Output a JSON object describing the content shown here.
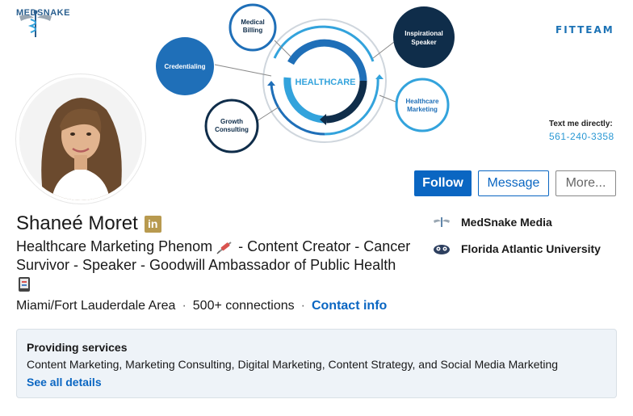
{
  "banner": {
    "brand_name": "MEDSNAKE",
    "center_label": "HEALTHCARE",
    "bubbles": {
      "medical_billing": "Medical Billing",
      "credentialing": "Credentialing",
      "growth_consulting": "Growth Consulting",
      "inspirational_speaker": "Inspirational Speaker",
      "healthcare_marketing": "Healthcare Marketing"
    },
    "sponsor": "FITTEAM",
    "text_me": "Text me directly:",
    "phone": "561-240-3358"
  },
  "actions": {
    "follow": "Follow",
    "message": "Message",
    "more": "More..."
  },
  "profile": {
    "name": "Shaneé Moret",
    "badge": "in",
    "headline_part1": "Healthcare Marketing Phenom",
    "headline_part2": "- Content Creator - Cancer Survivor - Speaker - Goodwill Ambassador of Public Health",
    "location": "Miami/Fort Lauderdale Area",
    "separator": "·",
    "connections": "500+ connections",
    "contact_info": "Contact info"
  },
  "organizations": [
    {
      "name": "MedSnake Media",
      "icon": "medsnake-logo-icon"
    },
    {
      "name": "Florida Atlantic University",
      "icon": "fau-owl-icon"
    }
  ],
  "services": {
    "title": "Providing services",
    "list": "Content Marketing, Marketing Consulting, Digital Marketing, Content Strategy, and Social Media Marketing",
    "link": "See all details"
  },
  "colors": {
    "accent": "#0a66c2",
    "banner_dark": "#0f2d4a",
    "banner_blue": "#1f6fb8",
    "banner_light": "#33a3dc",
    "badge_gold": "#b89a4f",
    "services_bg": "#eef3f8"
  }
}
